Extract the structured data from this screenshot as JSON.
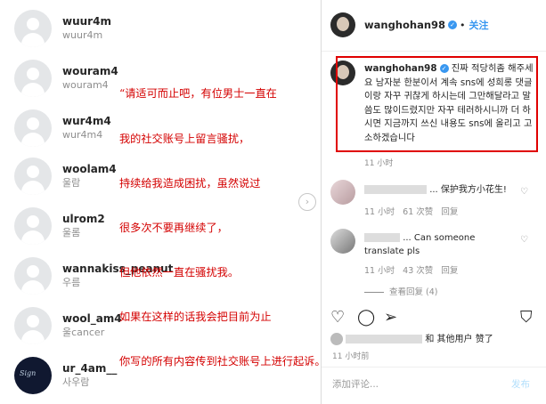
{
  "following": [
    {
      "username": "wuur4m",
      "subtitle": "wuur4m"
    },
    {
      "username": "wouram4",
      "subtitle": "wouram4"
    },
    {
      "username": "wur4m4",
      "subtitle": "wur4m4"
    },
    {
      "username": "woolam4",
      "subtitle": "울람"
    },
    {
      "username": "ulrom2",
      "subtitle": "울롬"
    },
    {
      "username": "wannakiss_peanut",
      "subtitle": "우름"
    },
    {
      "username": "wool_am4",
      "subtitle": "울cancer"
    },
    {
      "username": "ur_4am__",
      "subtitle": "사우람"
    }
  ],
  "overlay_lines": [
    "“请适可而止吧，有位男士一直在",
    "我的社交账号上留言骚扰，",
    "持续给我造成困扰，虽然说过",
    "很多次不要再继续了，",
    "但他依然一直在骚扰我。",
    "如果在这样的话我会把目前为止",
    "你写的所有内容传到社交账号上进行起诉。”"
  ],
  "post": {
    "author": "wanghohan98",
    "follow_separator": "•",
    "follow": "关注",
    "caption_author": "wanghohan98",
    "caption": "진짜 적당히좀 해주세요 남자분 한분이서 계속 sns에 성희롱 댓글이랑 자꾸 귀찮게 하시는데 그만해달라고 말씀도 많이드렸지만 자꾸 테러하시니까 더 하시면 지금까지 쓰신 내용도 sns에 올리고 고소하겠습니다",
    "caption_time": "11 小时"
  },
  "comments": [
    {
      "text": "... 保护我方小花生!",
      "time": "11 小时",
      "likes": "61 次赞",
      "reply": "回复"
    },
    {
      "text": "... Can someone translate pls",
      "time": "11 小时",
      "likes": "43 次赞",
      "reply": "回复",
      "view_replies": "查看回复 (4)"
    }
  ],
  "liked_by": "和 其他用户 赞了",
  "post_time": "11 小时前",
  "add_comment_placeholder": "添加评论...",
  "post_button": "发布",
  "icons": {
    "heart": "heart-icon",
    "comment": "comment-icon",
    "share": "share-icon",
    "save": "bookmark-icon",
    "next": "chevron-right-icon"
  },
  "accent": "#3897f0",
  "annotation_color": "#d40000",
  "highlight_box_color": "#e00000"
}
